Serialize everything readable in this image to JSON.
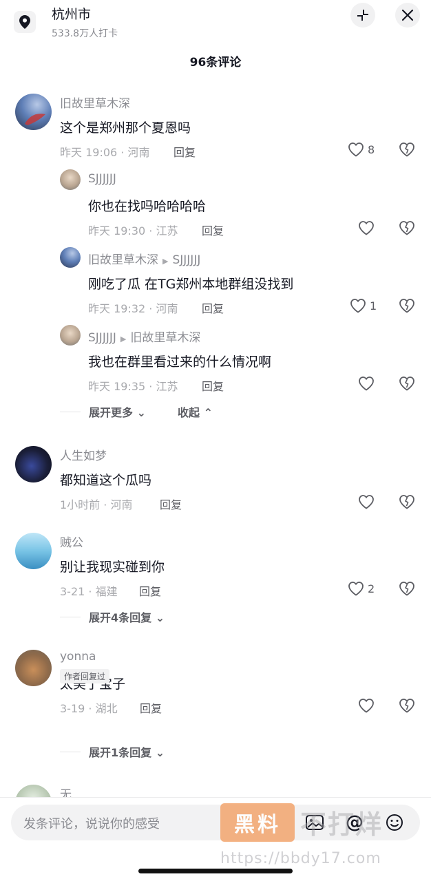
{
  "header": {
    "location_title": "杭州市",
    "location_sub": "533.8万人打卡"
  },
  "comment_count": "96条评论",
  "reply_label": "回复",
  "comments": [
    {
      "name": "旧故里草木深",
      "text": "这个是郑州那个夏恩吗",
      "meta": "昨天 19:06 · 河南",
      "likes": "8",
      "replies": [
        {
          "name": "SJJJJJJ",
          "reply_to": "",
          "text": "你也在找吗哈哈哈哈",
          "meta": "昨天 19:30 · 江苏",
          "likes": ""
        },
        {
          "name": "旧故里草木深",
          "reply_to": "SJJJJJJ",
          "text": "刚吃了瓜 在TG郑州本地群组没找到",
          "meta": "昨天 19:32 · 河南",
          "likes": "1"
        },
        {
          "name": "SJJJJJJ",
          "reply_to": "旧故里草木深",
          "text": "我也在群里看过来的什么情况啊",
          "meta": "昨天 19:35 · 江苏",
          "likes": ""
        }
      ],
      "expand_label": "展开更多",
      "collapse_label": "收起"
    },
    {
      "name": "人生如梦",
      "text": "都知道这个瓜吗",
      "meta": "1小时前 · 河南",
      "likes": ""
    },
    {
      "name": "贼公",
      "text": "别让我现实碰到你",
      "meta": "3-21 · 福建",
      "likes": "2",
      "expand_label": "展开4条回复"
    },
    {
      "name": "yonna",
      "text": "太美了宝子",
      "meta": "3-19 · 湖北",
      "likes": "",
      "author_tag": "作者回复过",
      "expand_label": "展开1条回复"
    },
    {
      "name": "无"
    }
  ],
  "input": {
    "placeholder": "发条评论，说说你的感受"
  },
  "watermark": {
    "badge": "黑料",
    "text": "不打烊",
    "url": "https://bbdy17.com"
  },
  "colors": {
    "text_primary": "#161823",
    "text_secondary": "#8a8b91",
    "text_meta": "#a8a9ad",
    "watermark_badge": "#f3a56e"
  }
}
